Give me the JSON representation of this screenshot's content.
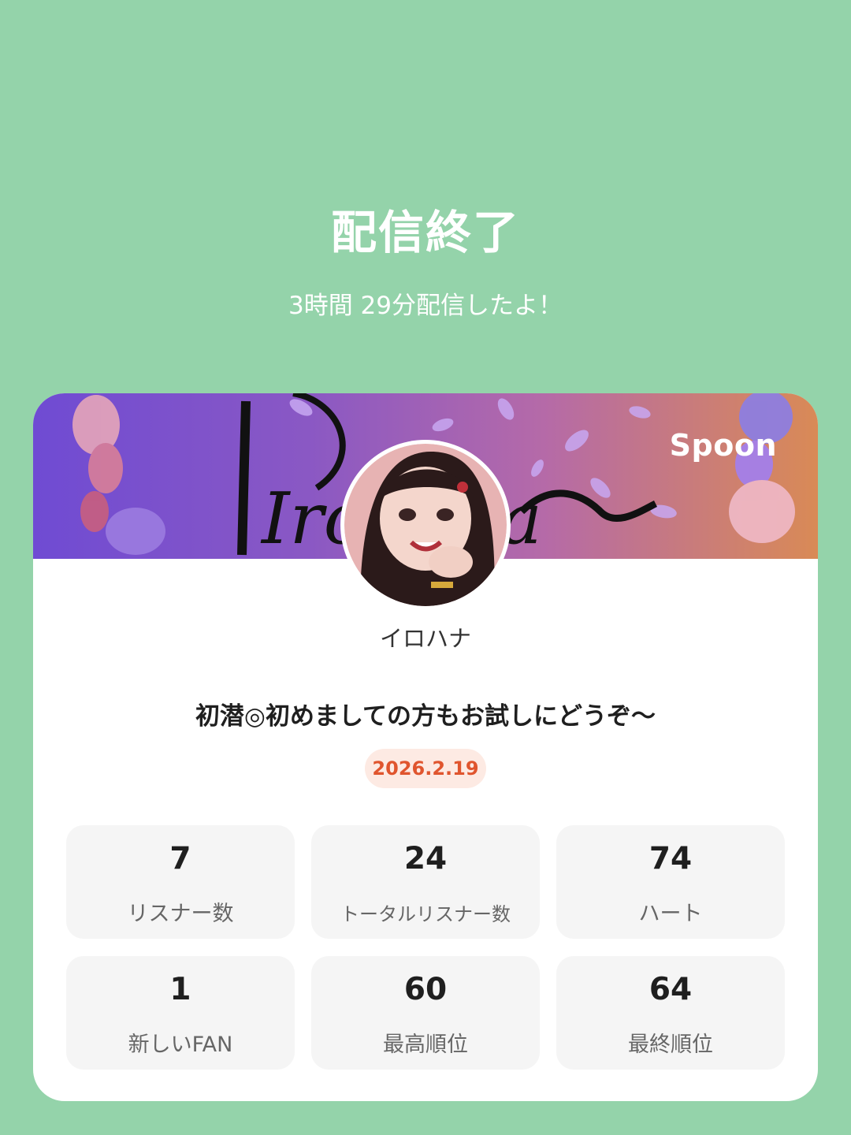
{
  "header": {
    "title": "配信終了",
    "subtitle": "3時間 29分配信したよ！"
  },
  "card": {
    "banner_logo": "Spoon",
    "banner_text": "Irohana",
    "username": "イロハナ",
    "live_title": "初潜◎初めましての方もお試しにどうぞ〜",
    "date": "2026.2.19",
    "stats": [
      {
        "value": "7",
        "label": "リスナー数"
      },
      {
        "value": "24",
        "label": "トータルリスナー数"
      },
      {
        "value": "74",
        "label": "ハート"
      },
      {
        "value": "1",
        "label": "新しいFAN"
      },
      {
        "value": "60",
        "label": "最高順位"
      },
      {
        "value": "64",
        "label": "最終順位"
      }
    ]
  },
  "colors": {
    "background": "#94d3aa",
    "card": "#ffffff",
    "date_text": "#e0552e",
    "date_badge": "#fdeae3",
    "stat_tile": "#f5f5f5"
  }
}
